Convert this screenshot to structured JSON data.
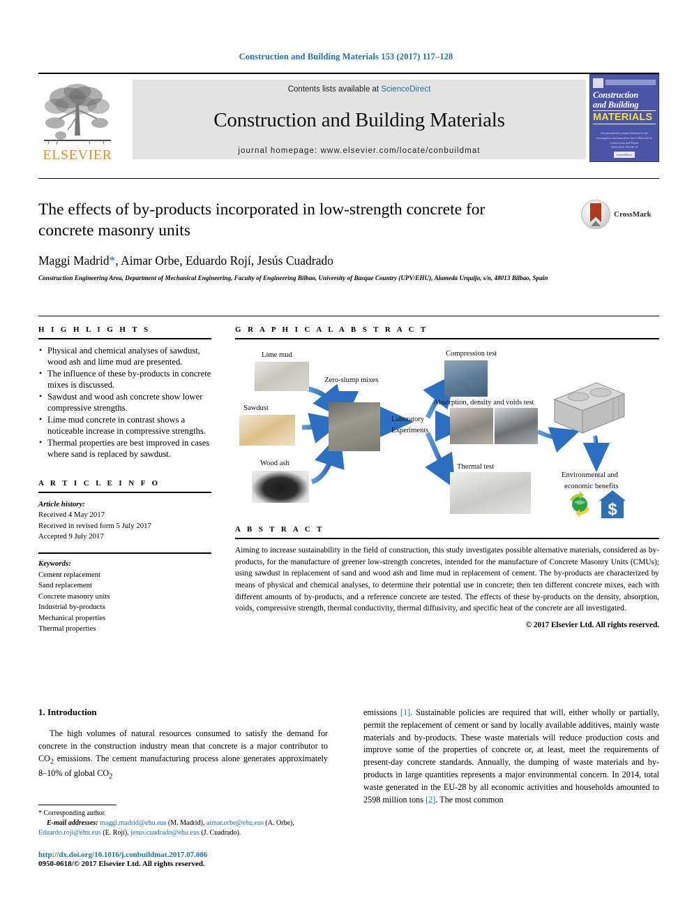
{
  "running_head": "Construction and Building Materials 153 (2017) 117–128",
  "masthead": {
    "publisher": "ELSEVIER",
    "contents_prefix": "Contents lists available at ",
    "contents_link": "ScienceDirect",
    "journal_title": "Construction and Building Materials",
    "homepage": "journal homepage: www.elsevier.com/locate/conbuildmat",
    "cover": {
      "line1": "Construction",
      "line2": "and Building",
      "line3": "MATERIALS",
      "blurb": "An international journal dedicated to the investigation and innovative use of Materials in Construction and Repair",
      "foot": "AVAILABLE ONLINE AT",
      "badge": "ScienceDirect"
    }
  },
  "article": {
    "title": "The effects of by-products incorporated in low-strength concrete for concrete masonry units",
    "authors_pre": "Maggi Madrid",
    "corresponding_mark": "*",
    "authors_post": ", Aimar Orbe, Eduardo Rojí, Jesús Cuadrado",
    "affiliation": "Construction Engineering Area, Department of Mechanical Engineering, Faculty of Engineering Bilbao, University of Basque Country (UPV/EHU), Alameda Urquijo, s/n, 48013 Bilbao, Spain",
    "crossmark_label": "CrossMark"
  },
  "highlights": {
    "heading": "H I G H L I G H T S",
    "items": [
      "Physical and chemical analyses of sawdust, wood ash and lime mud are presented.",
      "The influence of these by-products in concrete mixes is discussed.",
      "Sawdust and wood ash concrete show lower compressive strengths.",
      "Lime mud concrete in contrast shows a noticeable increase in compressive strengths.",
      "Thermal properties are best improved in cases where sand is replaced by sawdust."
    ]
  },
  "article_info": {
    "heading": "A R T I C L E   I N F O",
    "history_label": "Article history:",
    "history": [
      "Received 4 May 2017",
      "Received in revised form 5 July 2017",
      "Accepted 9 July 2017"
    ],
    "keywords_label": "Keywords:",
    "keywords": [
      "Cement replacement",
      "Sand replacement",
      "Concrete masonry units",
      "Industrial by-products",
      "Mechanical properties",
      "Thermal properties"
    ]
  },
  "graphical_abstract": {
    "heading": "G R A P H I C A L   A B S T R A C T",
    "labels": {
      "lime_mud": "Lime mud",
      "sawdust": "Sawdust",
      "wood_ash": "Wood ash",
      "zero_slump": "Zero-slump mixes",
      "laboratory": "Laboratory",
      "experiments": "Experiments",
      "compression": "Compression test",
      "absorption": "Absorption, density and voids test",
      "thermal": "Thermal test",
      "benefits_l1": "Environmental and",
      "benefits_l2": "economic benefits"
    }
  },
  "abstract": {
    "heading": "A B S T R A C T",
    "text": "Aiming to increase sustainability in the field of construction, this study investigates possible alternative materials, considered as by-products, for the manufacture of greener low-strength concretes, intended for the manufacture of Concrete Masonry Units (CMUs); using sawdust in replacement of sand and wood ash and lime mud in replacement of cement. The by-products are characterized by means of physical and chemical analyses, to determine their potential use in concrete; then ten different concrete mixes, each with different amounts of by-products, and a reference concrete are tested. The effects of these by-products on the density, absorption, voids, compressive strength, thermal conductivity, thermal diffusivity, and specific heat of the concrete are all investigated.",
    "copyright": "© 2017 Elsevier Ltd. All rights reserved."
  },
  "introduction": {
    "heading": "1. Introduction",
    "left_paragraph": "The high volumes of natural resources consumed to satisfy the demand for concrete in the construction industry mean that concrete is a major contributor to CO2 emissions. The cement manufacturing process alone generates approximately 8–10% of global CO2",
    "right_paragraph_pre": "emissions ",
    "right_cite_1": "[1]",
    "right_paragraph_mid": ". Sustainable policies are required that will, either wholly or partially, permit the replacement of cement or sand by locally available additives, mainly waste materials and by-products. These waste materials will reduce production costs and improve some of the properties of concrete or, at least, meet the requirements of present-day concrete standards. Annually, the dumping of waste materials and by-products in large quantities represents a major environmental concern. In 2014, total waste generated in the EU-28 by all economic activities and households amounted to 2598 million tons ",
    "right_cite_2": "[2]",
    "right_paragraph_end": ". The most common"
  },
  "footnote": {
    "corresponding": "* Corresponding author.",
    "email_label": "E-mail addresses:",
    "emails": [
      {
        "address": "maggi.madrid@ehu.eus",
        "name": "(M. Madrid),"
      },
      {
        "address": "aimar.orbe@ehu.eus",
        "name": "(A. Orbe),"
      },
      {
        "address": "Eduardo.roji@ehu.eus",
        "name": "(E. Rojí),"
      },
      {
        "address": "jesus.cuadrado@ehu.eus",
        "name": "(J. Cuadrado)."
      }
    ],
    "doi": "http://dx.doi.org/10.1016/j.conbuildmat.2017.07.086",
    "issn": "0950-0618/© 2017 Elsevier Ltd. All rights reserved."
  },
  "colors": {
    "link": "#1f72a8",
    "elsevier_orange": "#ec8b22",
    "cover_blue": "#4a55a8",
    "cover_yellow": "#f4e03c",
    "arrow_blue": "#2a6fc0",
    "band_gray": "#e3e3e3"
  }
}
